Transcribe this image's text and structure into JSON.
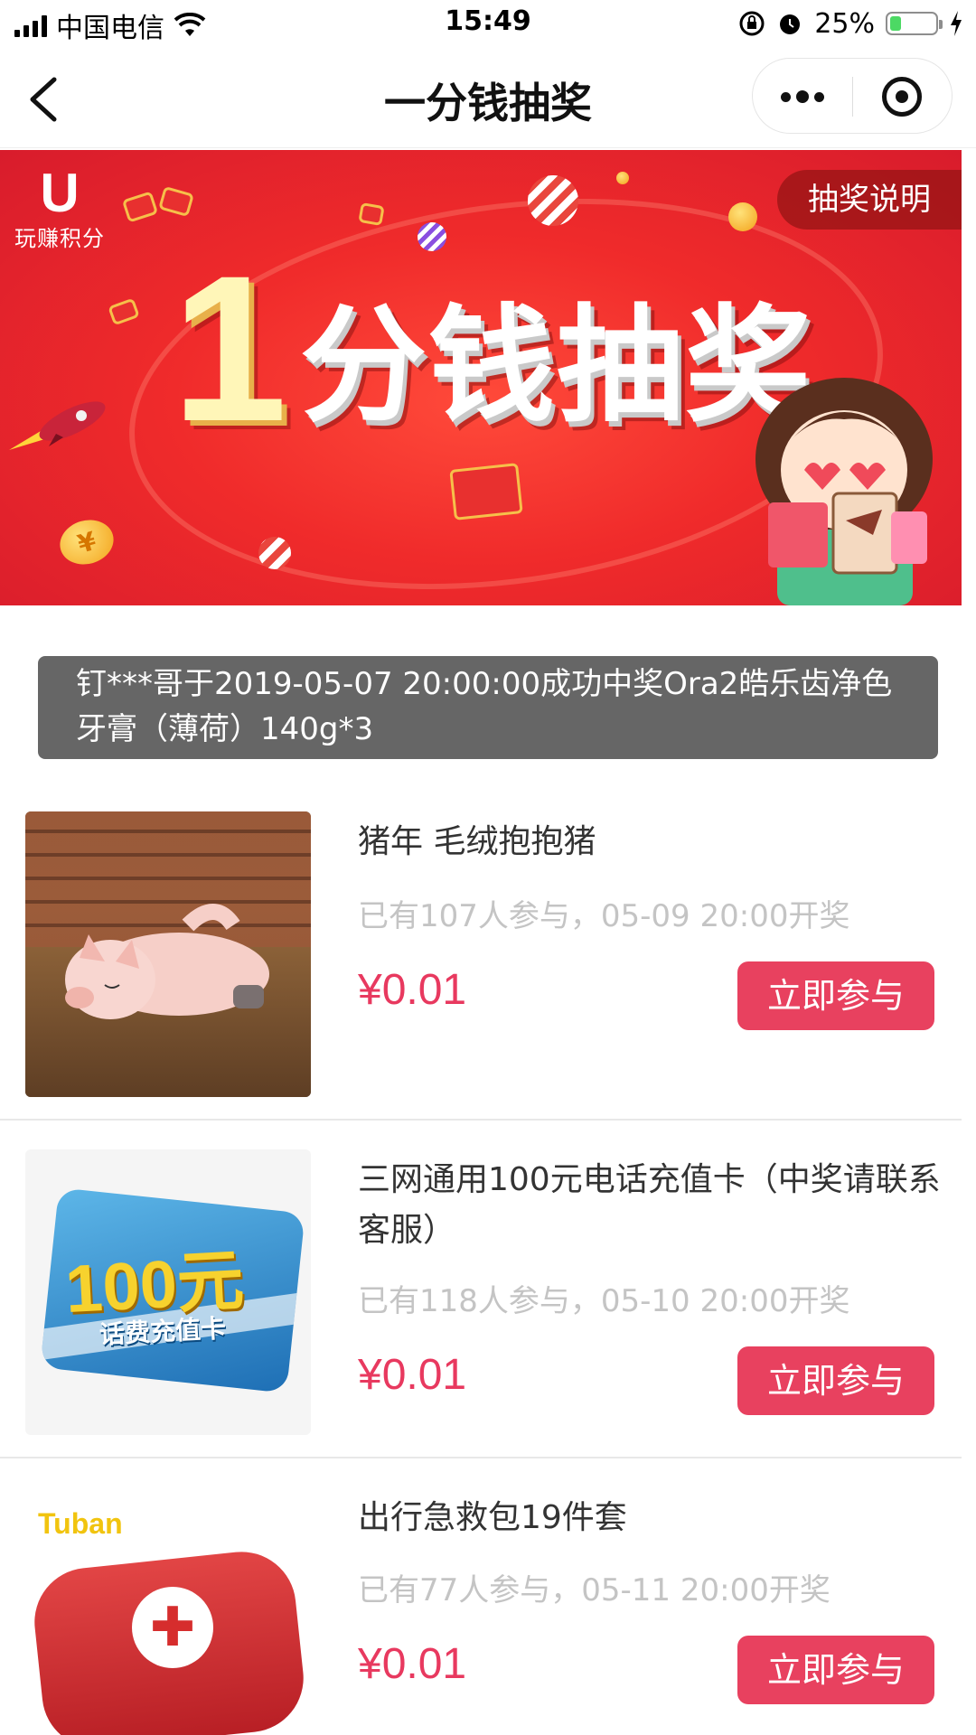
{
  "status_bar": {
    "carrier": "中国电信",
    "time": "15:49",
    "battery": "25%",
    "battery_level": 0.25
  },
  "nav": {
    "title": "一分钱抽奖"
  },
  "banner": {
    "logo_text": "玩赚积分",
    "headline_number": "1",
    "headline_text": "分钱抽奖",
    "rules_button": "抽奖说明"
  },
  "ticker": {
    "text": "钉***哥于2019-05-07 20:00:00成功中奖Ora2皓乐齿净色牙膏（薄荷）140g*3"
  },
  "products": [
    {
      "title": "猪年 毛绒抱抱猪",
      "meta": "已有107人参与，05-09 20:00开奖",
      "price": "¥0.01",
      "button": "立即参与"
    },
    {
      "title": "三网通用100元电话充值卡（中奖请联系客服）",
      "meta": "已有118人参与，05-10 20:00开奖",
      "price": "¥0.01",
      "button": "立即参与",
      "image_text_big": "100元",
      "image_text_small": "话费充值卡"
    },
    {
      "title": "出行急救包19件套",
      "meta": "已有77人参与，05-11 20:00开奖",
      "price": "¥0.01",
      "button": "立即参与",
      "image_brand": "Tuban"
    }
  ],
  "colors": {
    "accent": "#e8415f",
    "price": "#e8395f",
    "banner_red": "#f02b2b",
    "ticker_bg": "#666666"
  }
}
